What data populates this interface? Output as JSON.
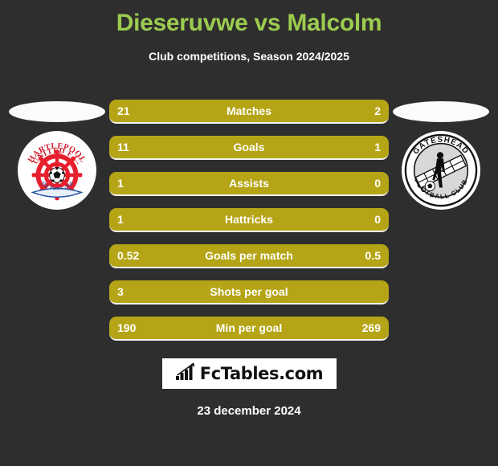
{
  "header": {
    "title": "Dieseruvwe vs Malcolm",
    "subtitle": "Club competitions, Season 2024/2025",
    "title_color": "#9ccc4f"
  },
  "theme": {
    "background": "#2e2e2e",
    "bar_color": "#b5a516",
    "bar_edge_color": "#f2f2f2",
    "text_color": "#ffffff"
  },
  "clubs": {
    "home": {
      "name": "Hartlepool United F.C.",
      "crest_text_top": "HARTLEPOOL",
      "crest_text_mid": "UNITED F.C.",
      "crest_ribbon": "The Pool's club"
    },
    "away": {
      "name": "Gateshead Football Club",
      "crest_text_top": "GATESHEAD",
      "crest_text_bottom": "FOOTBALL CLUB"
    }
  },
  "stats": [
    {
      "label": "Matches",
      "home": "21",
      "away": "2"
    },
    {
      "label": "Goals",
      "home": "11",
      "away": "1"
    },
    {
      "label": "Assists",
      "home": "1",
      "away": "0"
    },
    {
      "label": "Hattricks",
      "home": "1",
      "away": "0"
    },
    {
      "label": "Goals per match",
      "home": "0.52",
      "away": "0.5"
    },
    {
      "label": "Shots per goal",
      "home": "3",
      "away": ""
    },
    {
      "label": "Min per goal",
      "home": "190",
      "away": "269"
    }
  ],
  "footer": {
    "logo_text": "FcTables.com",
    "logo_icon": "bar-chart-growth-icon",
    "date": "23 december 2024"
  }
}
